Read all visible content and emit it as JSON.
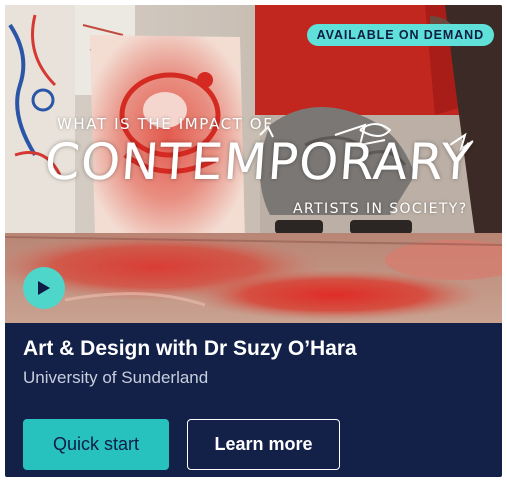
{
  "badge": {
    "label": "AVAILABLE ON DEMAND"
  },
  "hero": {
    "title_line1": "WHAT IS THE IMPACT OF",
    "title_line2": "CONTEMPORARY",
    "title_line3": "ARTISTS IN SOCIETY?",
    "play_icon": "play-icon"
  },
  "course": {
    "title": "Art & Design with Dr Suzy O’Hara",
    "provider": "University of Sunderland"
  },
  "actions": {
    "quick_start_label": "Quick start",
    "learn_more_label": "Learn more"
  },
  "colors": {
    "navy": "#132148",
    "teal": "#27c2bd",
    "badge_teal": "#5fe0d8",
    "white": "#ffffff"
  }
}
